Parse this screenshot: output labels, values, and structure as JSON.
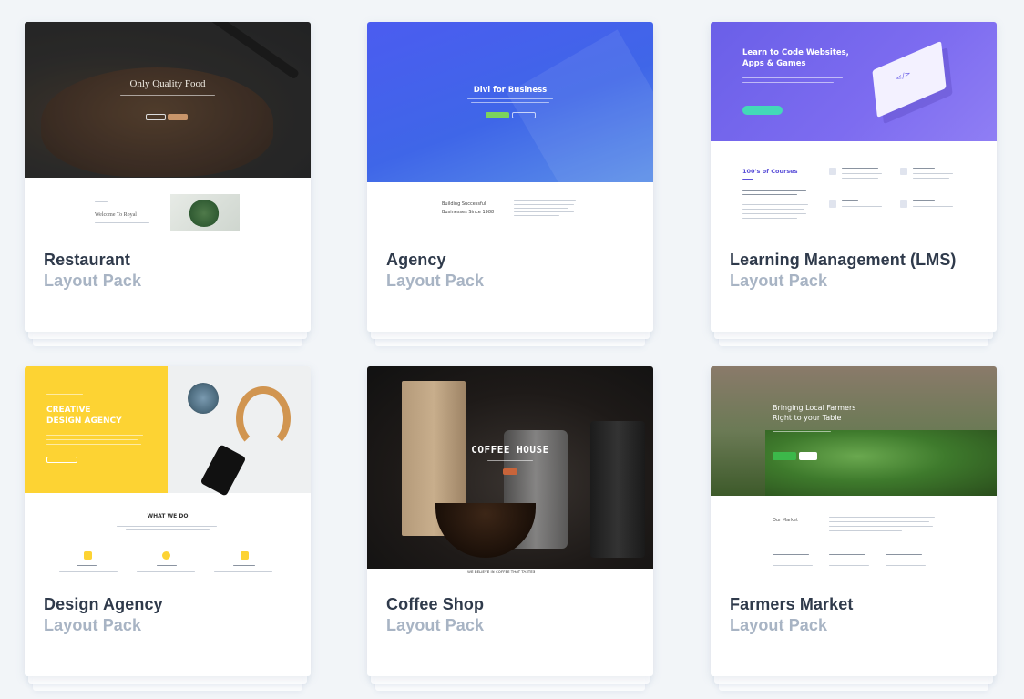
{
  "cards": [
    {
      "title": "Restaurant",
      "subtitle": "Layout Pack",
      "preview": {
        "hero_heading": "Only Quality Food",
        "section_heading": "Welcome To Royal"
      }
    },
    {
      "title": "Agency",
      "subtitle": "Layout Pack",
      "preview": {
        "hero_heading": "Divi for Business",
        "section_heading_1": "Building Successful",
        "section_heading_2": "Businesses Since 1988"
      }
    },
    {
      "title": "Learning Management (LMS)",
      "subtitle": "Layout Pack",
      "preview": {
        "hero_heading_1": "Learn to Code Websites,",
        "hero_heading_2": "Apps & Games",
        "section_heading": "100's of Courses"
      }
    },
    {
      "title": "Design Agency",
      "subtitle": "Layout Pack",
      "preview": {
        "hero_heading_1": "CREATIVE",
        "hero_heading_2": "DESIGN AGENCY",
        "section_heading": "WHAT WE DO"
      }
    },
    {
      "title": "Coffee Shop",
      "subtitle": "Layout Pack",
      "preview": {
        "hero_heading": "COFFEE HOUSE",
        "section_heading": "WE BELIEVE IN COFFEE THAT TASTES"
      }
    },
    {
      "title": "Farmers Market",
      "subtitle": "Layout Pack",
      "preview": {
        "hero_heading_1": "Bringing Local Farmers",
        "hero_heading_2": "Right to your Table",
        "section_heading": "Our Market"
      }
    }
  ],
  "colors": {
    "background": "#f2f5f8",
    "title": "#2f3a4b",
    "subtitle": "#a8b4c4"
  }
}
